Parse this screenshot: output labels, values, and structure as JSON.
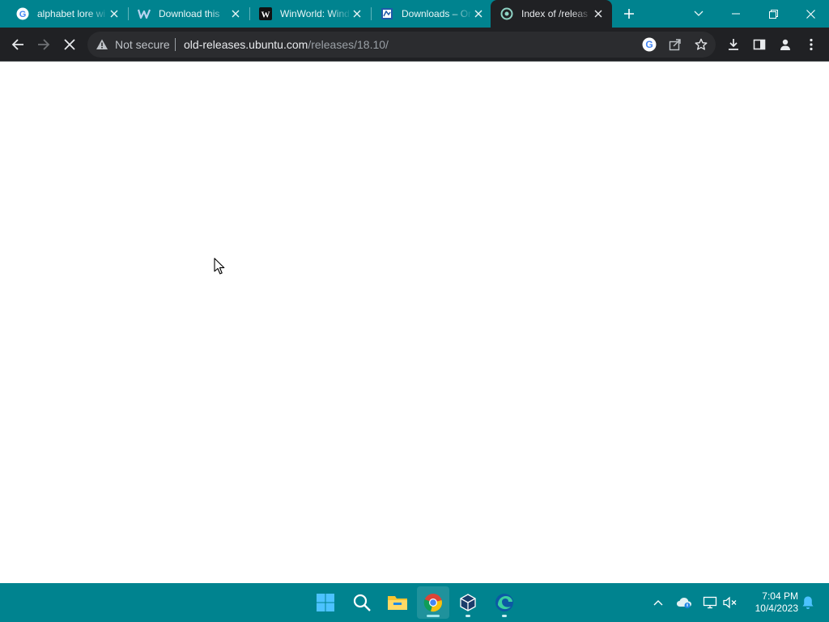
{
  "browser": {
    "tabs": [
      {
        "title": "alphabet lore wi",
        "icon": "google-icon",
        "active": false
      },
      {
        "title": "Download this",
        "icon": "w-site-icon",
        "active": false
      },
      {
        "title": "WinWorld: Wind",
        "icon": "winworld-icon",
        "active": false
      },
      {
        "title": "Downloads – Or",
        "icon": "doc-site-icon",
        "active": false
      },
      {
        "title": "Index of /releas",
        "icon": "loading-globe-icon",
        "active": true
      }
    ],
    "omnibox": {
      "security_label": "Not secure",
      "url_host": "old-releases.ubuntu.com",
      "url_path": "/releases/18.10/"
    }
  },
  "taskbar": {
    "apps": [
      "start",
      "search",
      "file-explorer",
      "chrome",
      "virtualbox",
      "edge"
    ],
    "clock_time": "7:04 PM",
    "clock_date": "10/4/2023"
  },
  "colors": {
    "accent": "#00838f",
    "toolbar": "#202124",
    "omnibox": "#2b2c2f"
  }
}
